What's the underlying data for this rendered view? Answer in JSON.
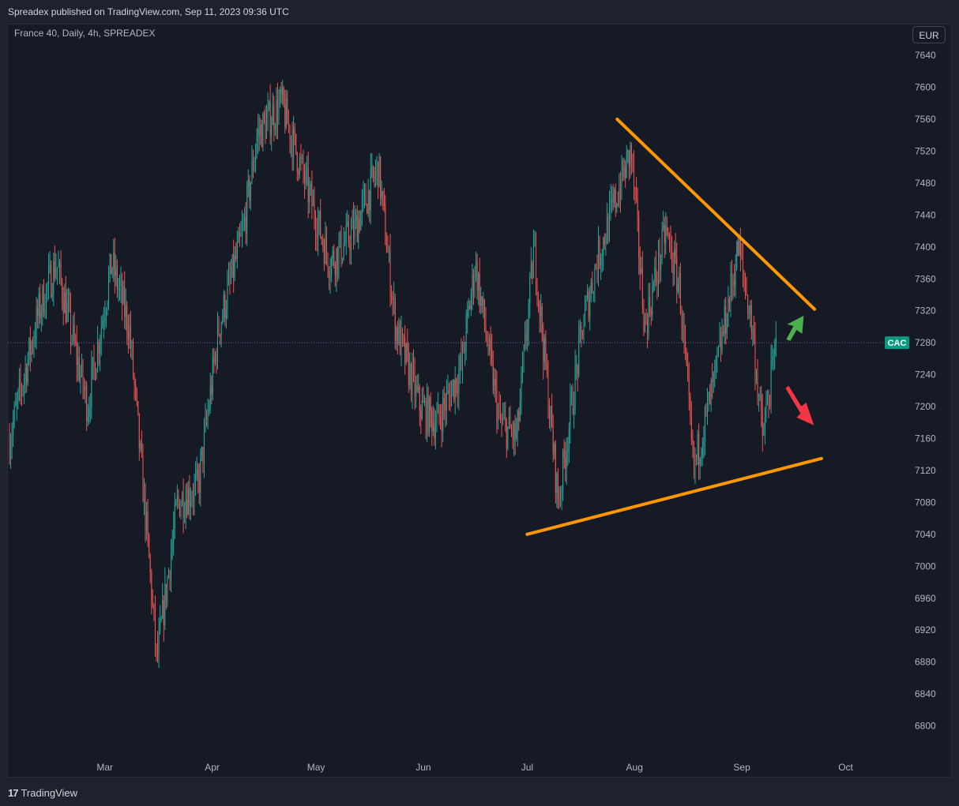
{
  "header": {
    "published": "Spreadex published on TradingView.com, Sep 11, 2023 09:36 UTC"
  },
  "chart": {
    "symbol_line": "France 40, Daily, 4h, SPREADEX",
    "currency": "EUR"
  },
  "footer": {
    "brand": "TradingView"
  },
  "colors": {
    "up": "#26a69a",
    "down": "#ef5350",
    "trend": "#ff9800",
    "arrow_up": "#4caf50",
    "arrow_down": "#f23645",
    "badge": "#089981"
  },
  "chart_data": {
    "type": "candlestick",
    "title": "France 40",
    "ylim": [
      6760,
      7650
    ],
    "y_ticks": [
      6800,
      6840,
      6880,
      6920,
      6960,
      7000,
      7040,
      7080,
      7120,
      7160,
      7200,
      7240,
      7280,
      7320,
      7360,
      7400,
      7440,
      7480,
      7520,
      7560,
      7600,
      7640
    ],
    "x_ticks": [
      "Mar",
      "Apr",
      "May",
      "Jun",
      "Jul",
      "Aug",
      "Sep",
      "Oct"
    ],
    "x_start": "2023-02-01",
    "x_end": "2023-10-10",
    "current_price": 7280,
    "price_label": "CAC",
    "path": [
      [
        "2023-02-01",
        7150
      ],
      [
        "2023-02-10",
        7320
      ],
      [
        "2023-02-15",
        7380
      ],
      [
        "2023-02-24",
        7200
      ],
      [
        "2023-03-03",
        7380
      ],
      [
        "2023-03-08",
        7300
      ],
      [
        "2023-03-13",
        7050
      ],
      [
        "2023-03-16",
        6880
      ],
      [
        "2023-03-22",
        7080
      ],
      [
        "2023-03-28",
        7100
      ],
      [
        "2023-04-03",
        7300
      ],
      [
        "2023-04-10",
        7420
      ],
      [
        "2023-04-14",
        7540
      ],
      [
        "2023-04-21",
        7580
      ],
      [
        "2023-04-28",
        7480
      ],
      [
        "2023-05-05",
        7380
      ],
      [
        "2023-05-12",
        7420
      ],
      [
        "2023-05-19",
        7500
      ],
      [
        "2023-05-24",
        7300
      ],
      [
        "2023-05-31",
        7200
      ],
      [
        "2023-06-05",
        7180
      ],
      [
        "2023-06-12",
        7250
      ],
      [
        "2023-06-16",
        7380
      ],
      [
        "2023-06-23",
        7180
      ],
      [
        "2023-06-28",
        7160
      ],
      [
        "2023-07-03",
        7400
      ],
      [
        "2023-07-10",
        7080
      ],
      [
        "2023-07-17",
        7300
      ],
      [
        "2023-07-21",
        7380
      ],
      [
        "2023-07-28",
        7480
      ],
      [
        "2023-07-31",
        7520
      ],
      [
        "2023-08-04",
        7300
      ],
      [
        "2023-08-10",
        7420
      ],
      [
        "2023-08-14",
        7350
      ],
      [
        "2023-08-18",
        7120
      ],
      [
        "2023-08-24",
        7230
      ],
      [
        "2023-08-31",
        7400
      ],
      [
        "2023-09-04",
        7300
      ],
      [
        "2023-09-07",
        7160
      ],
      [
        "2023-09-11",
        7280
      ]
    ],
    "annotations": [
      {
        "type": "trendline",
        "from": [
          "2023-07-27",
          7560
        ],
        "to": [
          "2023-09-22",
          7322
        ]
      },
      {
        "type": "trendline",
        "from": [
          "2023-07-01",
          7040
        ],
        "to": [
          "2023-09-24",
          7135
        ]
      },
      {
        "type": "arrow",
        "direction": "up",
        "at": [
          "2023-09-15",
          7300
        ]
      },
      {
        "type": "arrow",
        "direction": "down",
        "at": [
          "2023-09-15",
          7222
        ]
      }
    ]
  }
}
